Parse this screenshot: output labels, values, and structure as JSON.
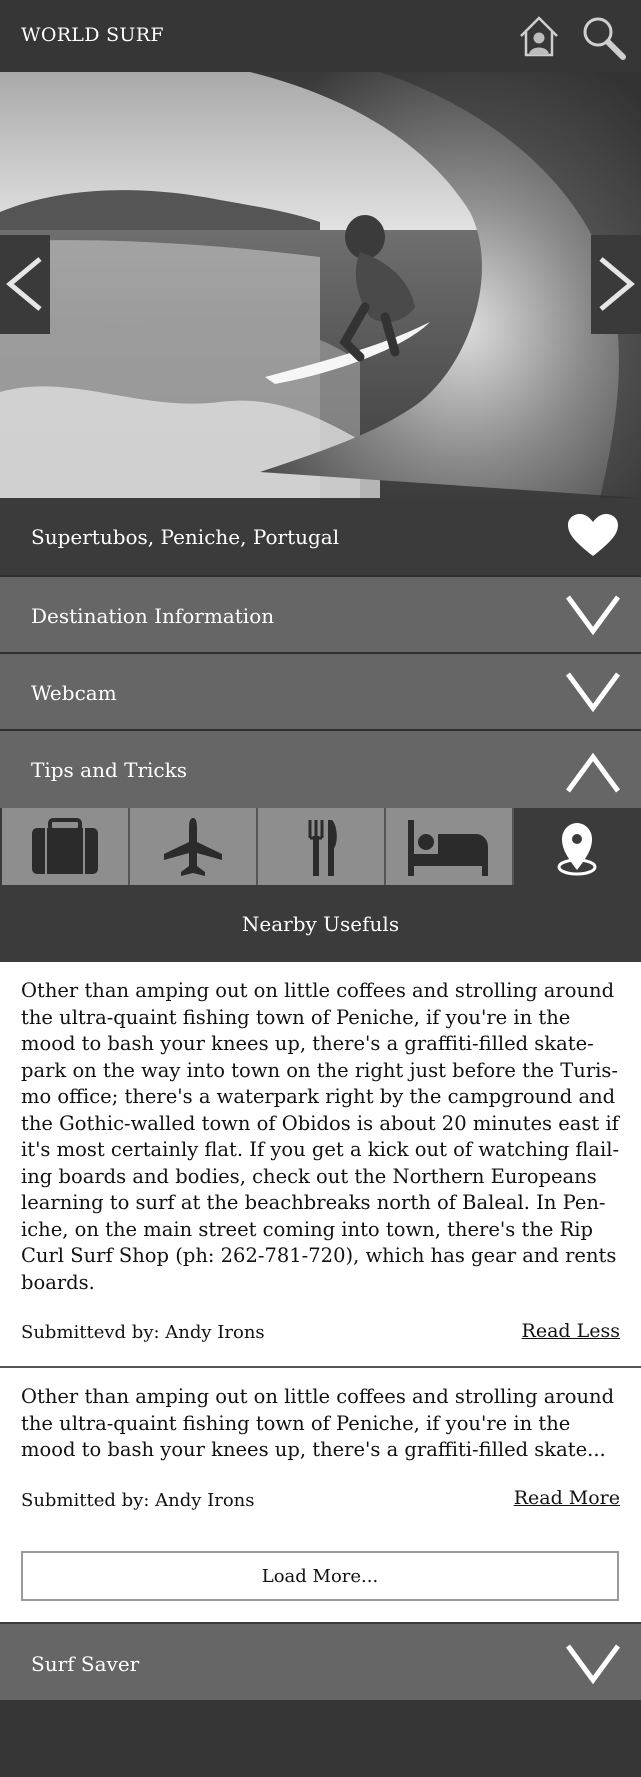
{
  "header": {
    "brand": "WORLD SURF",
    "icons": [
      "home-icon",
      "search-icon"
    ]
  },
  "hero": {
    "prev_icon": "chevron-left-icon",
    "next_icon": "chevron-right-icon"
  },
  "location": {
    "title": "Supertubos, Peniche, Portugal",
    "favorite_icon": "heart-icon"
  },
  "sections": [
    {
      "label": "Destination Information",
      "state": "collapsed"
    },
    {
      "label": "Webcam",
      "state": "collapsed"
    },
    {
      "label": "Tips and Tricks",
      "state": "expanded"
    }
  ],
  "tabs": [
    {
      "icon": "suitcase-icon",
      "active": false
    },
    {
      "icon": "airplane-icon",
      "active": false
    },
    {
      "icon": "fork-knife-icon",
      "active": false
    },
    {
      "icon": "bed-icon",
      "active": false
    },
    {
      "icon": "map-pin-icon",
      "active": true
    }
  ],
  "nearby": {
    "title": "Nearby Usefuls"
  },
  "tips": [
    {
      "lines": [
        "Other than amping out on little coffees and strolling around",
        "the ultra-quaint fishing town of Peniche, if you're in the",
        "mood to bash your knees up, there's a graffiti-filled skate-",
        "park on the way into town on the right just before the Turis-",
        "mo office; there's a waterpark right by the campground and",
        "the Gothic-walled town of Obidos is about 20 minutes east if",
        "it's most certainly flat. If you get a kick out of watching flail-",
        "ing boards and bodies, check out the Northern Europeans",
        "learning to surf at the beachbreaks north of Baleal. In Pen-",
        "iche, on the main street coming into town, there's the Rip",
        "Curl Surf Shop (ph: 262-781-720), which has gear and rents",
        "boards."
      ],
      "submitted": "Submittevd by:  Andy Irons",
      "link": "Read Less"
    },
    {
      "lines": [
        "Other than amping out on little coffees and strolling around",
        "the ultra-quaint fishing town of Peniche, if you're in the",
        "mood to bash your knees up, there's a graffiti-filled skate..."
      ],
      "submitted": "Submitted by:  Andy Irons",
      "link": "Read More"
    }
  ],
  "load_more": "Load More...",
  "surf_saver": {
    "label": "Surf Saver",
    "state": "collapsed"
  }
}
